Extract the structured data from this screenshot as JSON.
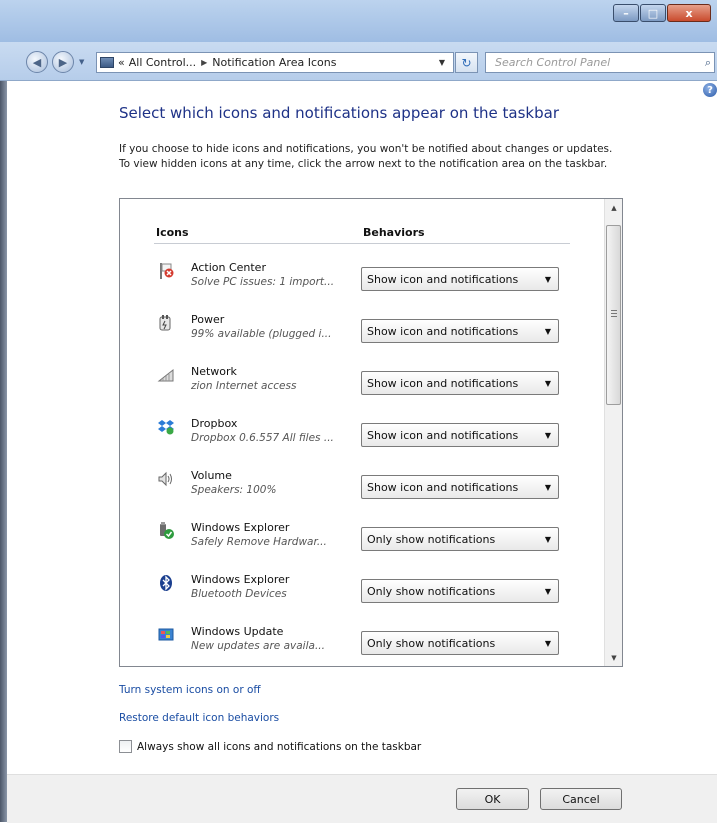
{
  "window": {
    "buttons": {
      "minimize": "–",
      "maximize": "□",
      "close": "x"
    }
  },
  "address_bar": {
    "back": "◀",
    "forward": "▶",
    "overflow": "«",
    "crumbs": [
      "All Control...",
      "Notification Area Icons"
    ],
    "separator": "▶",
    "dropdown": "▼",
    "refresh": "↻",
    "search_placeholder": "Search Control Panel",
    "search_icon": "⌕"
  },
  "help_icon": "?",
  "main": {
    "heading": "Select which icons and notifications appear on the taskbar",
    "description": "If you choose to hide icons and notifications, you won't be notified about changes or updates. To view hidden icons at any time, click the arrow next to the notification area on the taskbar.",
    "columns": {
      "icons": "Icons",
      "behaviors": "Behaviors"
    },
    "rows": [
      {
        "name": "Action Center",
        "detail": "Solve PC issues: 1 import...",
        "behavior": "Show icon and notifications",
        "icon": "action-center-flag-icon"
      },
      {
        "name": "Power",
        "detail": "99% available (plugged i...",
        "behavior": "Show icon and notifications",
        "icon": "power-plug-icon"
      },
      {
        "name": "Network",
        "detail": "zion Internet access",
        "behavior": "Show icon and notifications",
        "icon": "network-signal-icon"
      },
      {
        "name": "Dropbox",
        "detail": "Dropbox 0.6.557 All files ...",
        "behavior": "Show icon and notifications",
        "icon": "dropbox-icon"
      },
      {
        "name": "Volume",
        "detail": "Speakers: 100%",
        "behavior": "Show icon and notifications",
        "icon": "speaker-icon"
      },
      {
        "name": "Windows Explorer",
        "detail": "Safely Remove Hardwar...",
        "behavior": "Only show notifications",
        "icon": "safely-remove-hardware-icon"
      },
      {
        "name": "Windows Explorer",
        "detail": "Bluetooth Devices",
        "behavior": "Only show notifications",
        "icon": "bluetooth-icon"
      },
      {
        "name": "Windows Update",
        "detail": "New updates are availa...",
        "behavior": "Only show notifications",
        "icon": "windows-update-icon"
      }
    ],
    "scroll": {
      "up": "▲",
      "down": "▼"
    },
    "links": {
      "system_icons": "Turn system icons on or off",
      "restore": "Restore default icon behaviors"
    },
    "always_show_label": "Always show all icons and notifications on the taskbar",
    "always_show_checked": false
  },
  "footer": {
    "ok": "OK",
    "cancel": "Cancel"
  }
}
